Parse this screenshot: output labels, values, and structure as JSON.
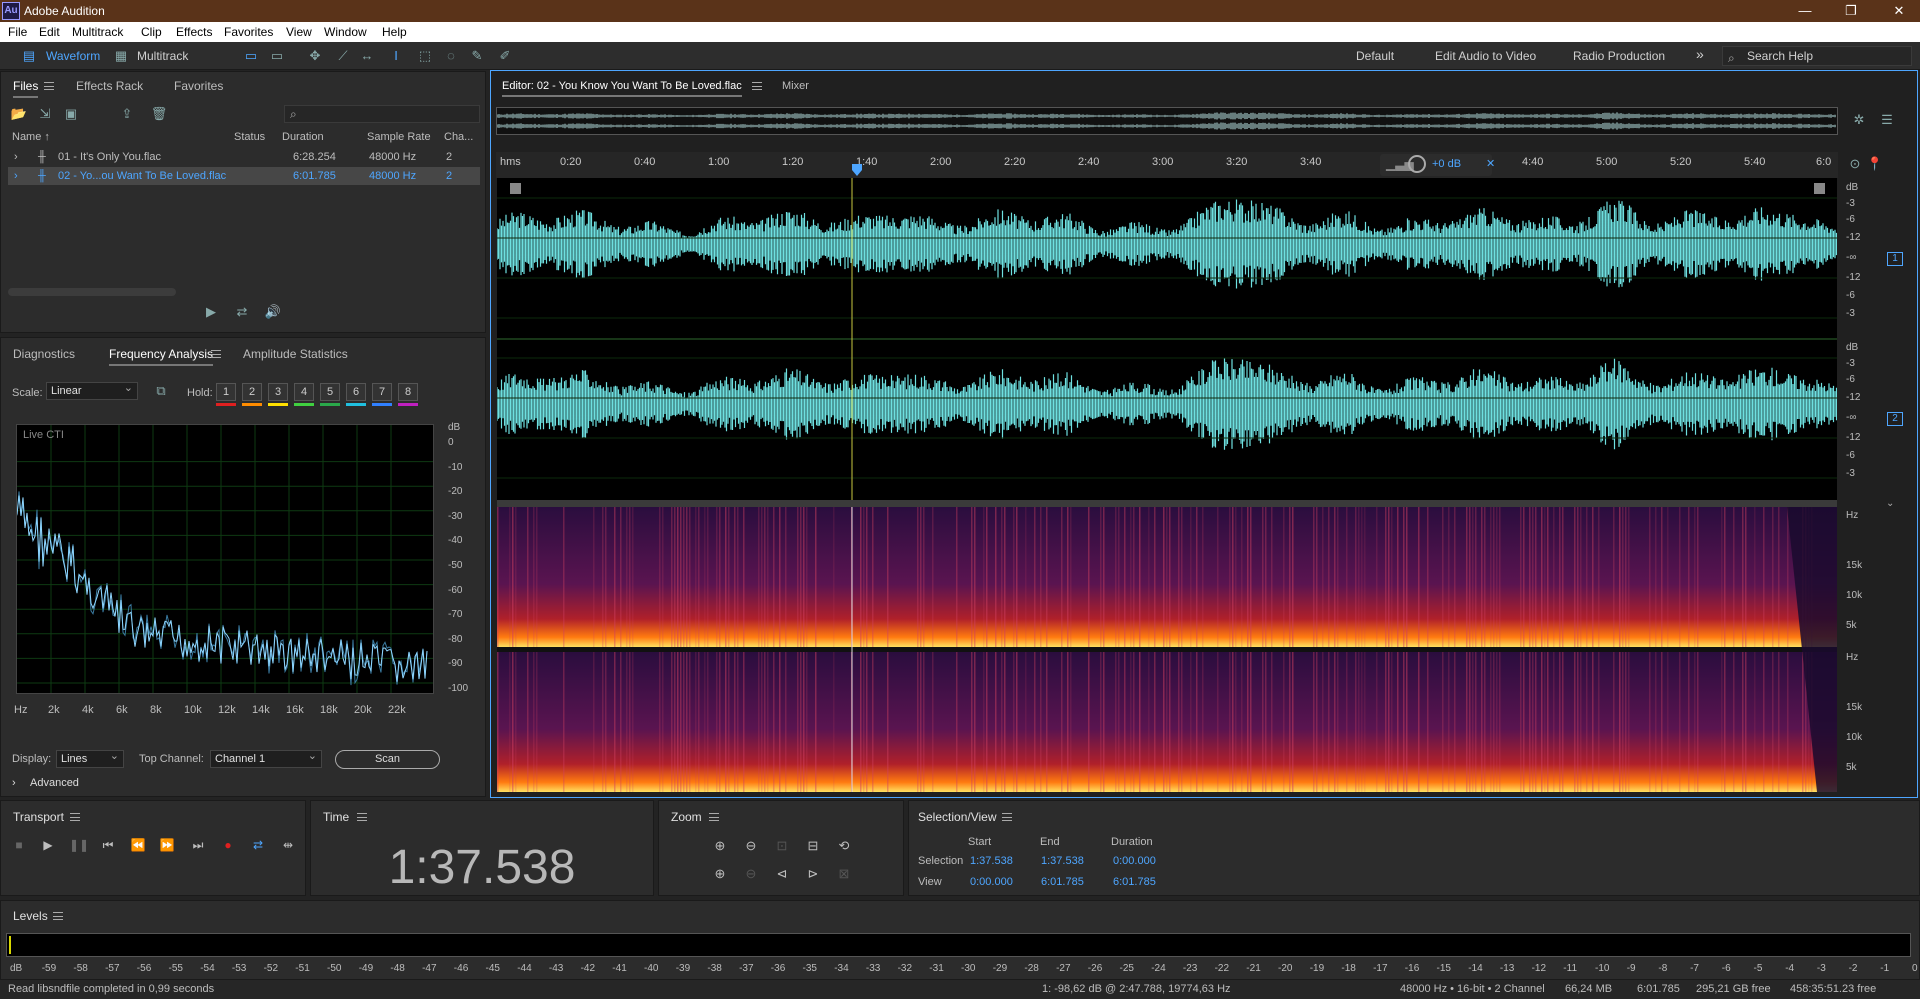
{
  "app": {
    "title": "Adobe Audition",
    "logo": "Au"
  },
  "window": {
    "minimize": "—",
    "restore": "❐",
    "close": "✕"
  },
  "menu": [
    "File",
    "Edit",
    "Multitrack",
    "Clip",
    "Effects",
    "Favorites",
    "View",
    "Window",
    "Help"
  ],
  "toolbar": {
    "waveform": "Waveform",
    "multitrack": "Multitrack",
    "workspaces": [
      "Default",
      "Edit Audio to Video",
      "Radio Production"
    ],
    "more": "»",
    "search_placeholder": "Search Help"
  },
  "files_panel": {
    "tabs": [
      "Files",
      "Effects Rack",
      "Favorites"
    ],
    "columns": [
      "Name ↑",
      "Status",
      "Duration",
      "Sample Rate",
      "Cha..."
    ],
    "rows": [
      {
        "name": "01 - It's Only You.flac",
        "duration": "6:28.254",
        "rate": "48000 Hz",
        "ch": "2"
      },
      {
        "name": "02 - Yo...ou Want To Be Loved.flac",
        "duration": "6:01.785",
        "rate": "48000 Hz",
        "ch": "2"
      }
    ]
  },
  "freq_panel": {
    "tabs": [
      "Diagnostics",
      "Frequency Analysis",
      "Amplitude Statistics"
    ],
    "scale_label": "Scale:",
    "scale": "Linear",
    "hold_label": "Hold:",
    "hold": [
      "1",
      "2",
      "3",
      "4",
      "5",
      "6",
      "7",
      "8"
    ],
    "hold_colors": [
      "#e02020",
      "#ff8c00",
      "#ffe000",
      "#40d040",
      "#2aa84a",
      "#20c0e0",
      "#3080ff",
      "#c020c0"
    ],
    "live": "Live CTI",
    "db_unit": "dB",
    "db_ticks": [
      "0",
      "-10",
      "-20",
      "-30",
      "-40",
      "-50",
      "-60",
      "-70",
      "-80",
      "-90",
      "-100"
    ],
    "x_ticks": [
      "Hz",
      "2k",
      "4k",
      "6k",
      "8k",
      "10k",
      "12k",
      "14k",
      "16k",
      "18k",
      "20k",
      "22k"
    ],
    "display_label": "Display:",
    "display": "Lines",
    "top_channel_label": "Top Channel:",
    "top_channel": "Channel 1",
    "scan": "Scan",
    "advanced": "Advanced"
  },
  "editor": {
    "tab": "Editor: 02 - You Know You Want To Be Loved.flac",
    "mixer": "Mixer",
    "ruler_unit": "hms",
    "ruler": [
      "0:20",
      "0:40",
      "1:00",
      "1:20",
      "1:40",
      "2:00",
      "2:20",
      "2:40",
      "3:00",
      "3:20",
      "3:40",
      "4:40",
      "5:00",
      "5:20",
      "5:40",
      "6:0"
    ],
    "gain": "+0 dB",
    "db_scale": [
      "dB",
      "-3",
      "-6",
      "-12",
      "-∞",
      "-12",
      "-6",
      "-3"
    ],
    "ch1": "1",
    "ch2": "2",
    "hz": "Hz",
    "spec_ticks": [
      "15k",
      "10k",
      "5k"
    ]
  },
  "transport": {
    "title": "Transport"
  },
  "time": {
    "title": "Time",
    "value": "1:37.538"
  },
  "zoom": {
    "title": "Zoom"
  },
  "selection": {
    "title": "Selection/View",
    "cols": [
      "Start",
      "End",
      "Duration"
    ],
    "selection_label": "Selection",
    "view_label": "View",
    "sel": [
      "1:37.538",
      "1:37.538",
      "0:00.000"
    ],
    "view": [
      "0:00.000",
      "6:01.785",
      "6:01.785"
    ]
  },
  "levels": {
    "title": "Levels",
    "ticks": [
      "dB",
      "-59",
      "-58",
      "-57",
      "-56",
      "-55",
      "-54",
      "-53",
      "-52",
      "-51",
      "-50",
      "-49",
      "-48",
      "-47",
      "-46",
      "-45",
      "-44",
      "-43",
      "-42",
      "-41",
      "-40",
      "-39",
      "-38",
      "-37",
      "-36",
      "-35",
      "-34",
      "-33",
      "-32",
      "-31",
      "-30",
      "-29",
      "-28",
      "-27",
      "-26",
      "-25",
      "-24",
      "-23",
      "-22",
      "-21",
      "-20",
      "-19",
      "-18",
      "-17",
      "-16",
      "-15",
      "-14",
      "-13",
      "-12",
      "-11",
      "-10",
      "-9",
      "-8",
      "-7",
      "-6",
      "-5",
      "-4",
      "-3",
      "-2",
      "-1",
      "0"
    ]
  },
  "status": {
    "left": "Read libsndfile completed in 0,99 seconds",
    "cursor": "1: -98,62 dB @ 2:47.788, 19774,63 Hz",
    "format": "48000 Hz • 16-bit • 2 Channel",
    "size": "66,24 MB",
    "duration": "6:01.785",
    "free": "295,21 GB free",
    "free_time": "458:35:51.23 free"
  }
}
